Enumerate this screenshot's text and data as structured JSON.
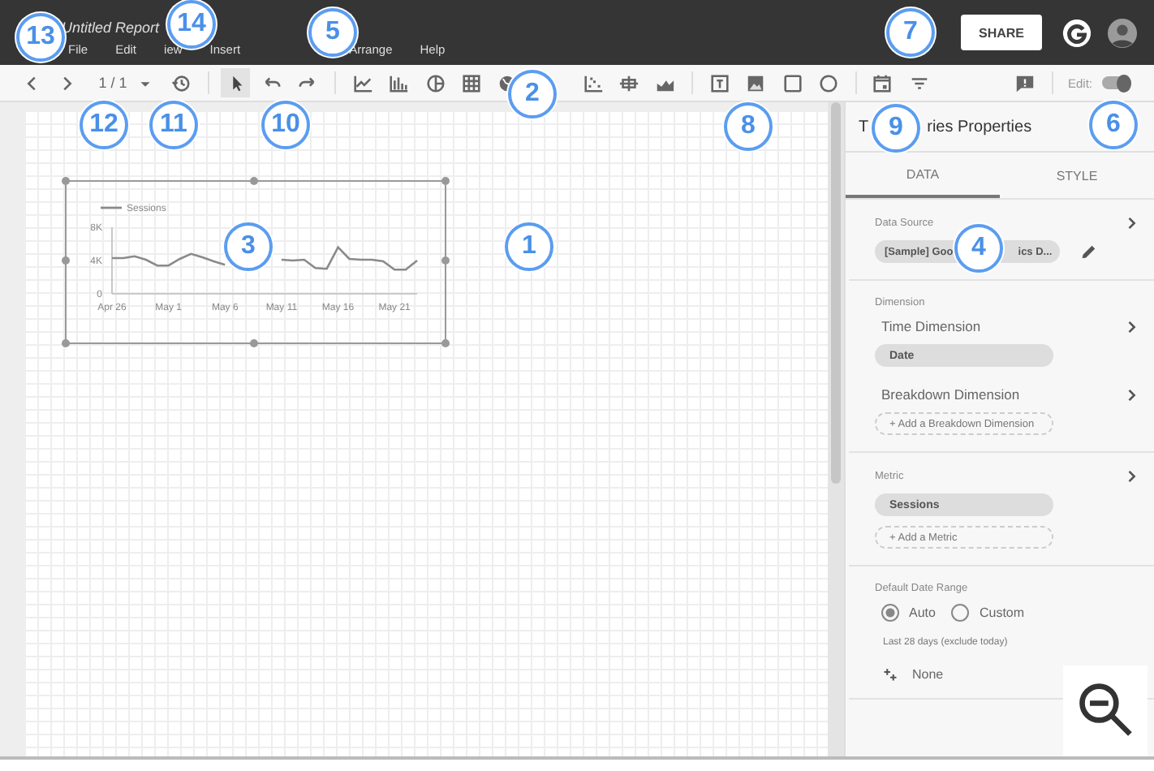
{
  "header": {
    "title": "Untitled Report",
    "share_button": "SHARE",
    "menus": [
      "File",
      "Edit",
      "iew",
      "Insert",
      "Arrange",
      "Help"
    ]
  },
  "toolbar": {
    "page_indicator": "1 / 1",
    "tools": [
      {
        "kind": "prev",
        "selected": false
      },
      {
        "kind": "next",
        "selected": false
      },
      {
        "kind": "page"
      },
      {
        "kind": "caret",
        "selected": false
      },
      {
        "kind": "history",
        "selected": false
      },
      {
        "kind": "sep"
      },
      {
        "kind": "pointer",
        "selected": true
      },
      {
        "kind": "undo",
        "selected": false
      },
      {
        "kind": "redo",
        "selected": false
      },
      {
        "kind": "sep"
      },
      {
        "kind": "linechart",
        "selected": false
      },
      {
        "kind": "barchart",
        "selected": false
      },
      {
        "kind": "pie",
        "selected": false
      },
      {
        "kind": "table",
        "selected": false
      },
      {
        "kind": "globe",
        "selected": false
      },
      {
        "kind": "gap"
      },
      {
        "kind": "scatter",
        "selected": false
      },
      {
        "kind": "bullet",
        "selected": false
      },
      {
        "kind": "area",
        "selected": false
      },
      {
        "kind": "sep"
      },
      {
        "kind": "text",
        "selected": false
      },
      {
        "kind": "image",
        "selected": false
      },
      {
        "kind": "rect",
        "selected": false
      },
      {
        "kind": "circle",
        "selected": false
      },
      {
        "kind": "sep"
      },
      {
        "kind": "calendar",
        "selected": false
      },
      {
        "kind": "filter",
        "selected": false
      },
      {
        "kind": "fill"
      },
      {
        "kind": "comment",
        "selected": false
      },
      {
        "kind": "sep"
      }
    ],
    "edit_toggle": {
      "label": "Edit:",
      "on": true
    }
  },
  "canvas": {
    "chart": {
      "chart_data": {
        "type": "line",
        "categories": [
          "Apr 26",
          null,
          null,
          null,
          null,
          "May 1",
          null,
          null,
          null,
          null,
          "May 6",
          null,
          null,
          null,
          null,
          "May 11",
          null,
          null,
          null,
          null,
          "May 16",
          null,
          null,
          null,
          null,
          "May 21",
          null,
          null
        ],
        "series": [
          {
            "name": "Sessions",
            "color": "#8a8a8a",
            "values": [
              4300,
              4300,
              4500,
              4100,
              3400,
              3400,
              4200,
              4800,
              4400,
              3900,
              3500,
              null,
              null,
              null,
              null,
              4100,
              4000,
              4100,
              3100,
              3000,
              5600,
              4200,
              4100,
              4100,
              3900,
              2900,
              2900,
              4000
            ]
          }
        ],
        "ylim": [
          0,
          8000
        ],
        "yticks": [
          {
            "value": 0,
            "label": "0"
          },
          {
            "value": 4000,
            "label": "4K"
          },
          {
            "value": 8000,
            "label": "8K"
          }
        ]
      }
    }
  },
  "panel": {
    "title_parts": [
      "T",
      "ries Properties"
    ],
    "tabs": [
      {
        "label": "DATA",
        "selected": true
      },
      {
        "label": "STYLE",
        "selected": false
      }
    ],
    "data_source": {
      "label": "Data Source",
      "chip_parts": [
        "[Sample] Goo",
        "ics D..."
      ]
    },
    "dimension": {
      "label": "Dimension",
      "time_label": "Time Dimension",
      "time_chip": "Date",
      "breakdown_label": "Breakdown Dimension",
      "add_breakdown": "+ Add a Breakdown Dimension"
    },
    "metric": {
      "label": "Metric",
      "chip": "Sessions",
      "add_metric": "+ Add a Metric"
    },
    "date_range": {
      "label": "Default Date Range",
      "options": [
        {
          "label": "Auto",
          "selected": true
        },
        {
          "label": "Custom",
          "selected": false
        }
      ],
      "note": "Last 28 days (exclude today)",
      "comparison": "None"
    }
  },
  "annotations": [
    "13",
    "14",
    "5",
    "7",
    "2",
    "12",
    "11",
    "10",
    "8",
    "9",
    "6",
    "3",
    "1",
    "4"
  ]
}
